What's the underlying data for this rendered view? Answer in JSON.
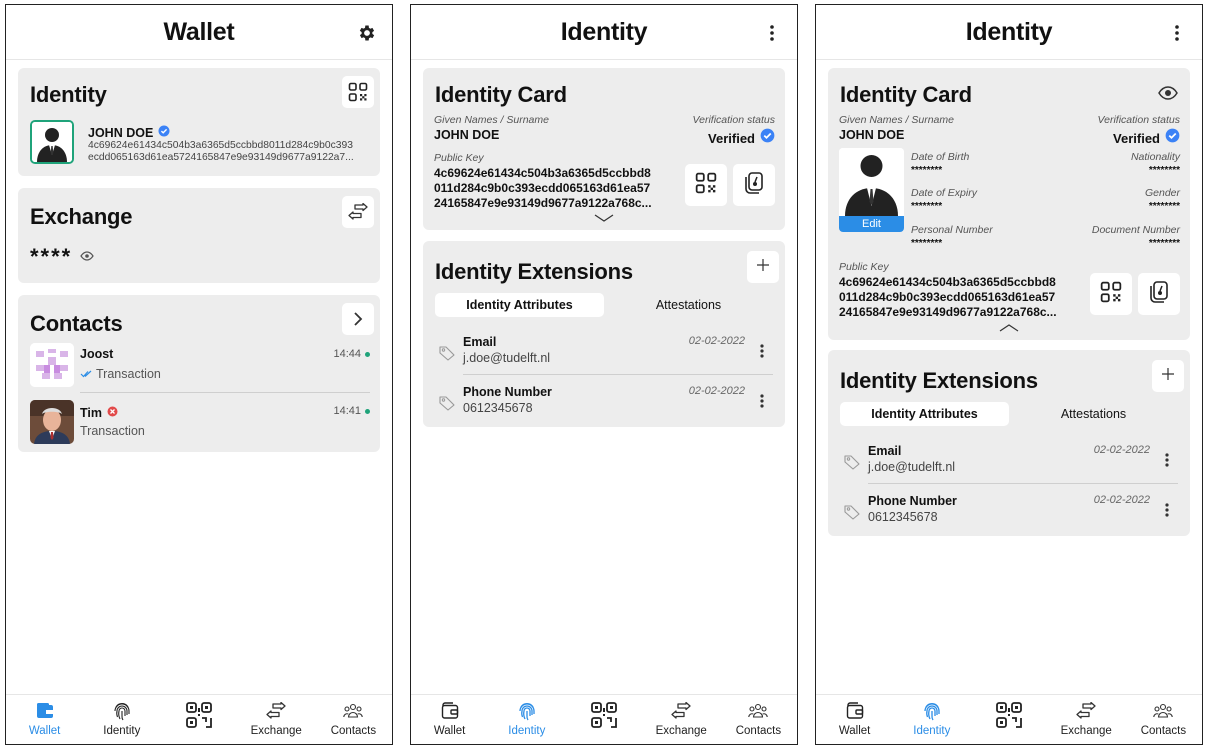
{
  "screens": {
    "wallet": {
      "title": "Wallet",
      "identity": {
        "title": "Identity",
        "name": "JOHN DOE",
        "key_line1": "4c69624e61434c504b3a6365d5ccbbd8011d284c9b0c393",
        "key_line2": "ecdd065163d61ea5724165847e9e93149d9677a9122a7..."
      },
      "exchange": {
        "title": "Exchange",
        "balance": "****"
      },
      "contacts": {
        "title": "Contacts",
        "items": [
          {
            "name": "Joost",
            "time": "14:44",
            "subtitle": "Transaction"
          },
          {
            "name": "Tim",
            "time": "14:41",
            "subtitle": "Transaction"
          }
        ]
      }
    },
    "identity": {
      "title": "Identity",
      "card_title": "Identity Card",
      "given_names_label": "Given Names / Surname",
      "name": "JOHN DOE",
      "verification_label": "Verification status",
      "verification_value": "Verified",
      "public_key_label": "Public Key",
      "public_key_line1": "4c69624e61434c504b3a6365d5ccbbd8",
      "public_key_line2": "011d284c9b0c393ecdd065163d61ea57",
      "public_key_line3": "24165847e9e93149d9677a9122a768c...",
      "extensions_title": "Identity Extensions",
      "tabs": [
        "Identity Attributes",
        "Attestations"
      ],
      "attributes": [
        {
          "name": "Email",
          "value": "j.doe@tudelft.nl",
          "date": "02-02-2022"
        },
        {
          "name": "Phone Number",
          "value": "0612345678",
          "date": "02-02-2022"
        }
      ],
      "expanded": {
        "dob_label": "Date of Birth",
        "dob_value": "********",
        "nationality_label": "Nationality",
        "nationality_value": "********",
        "expiry_label": "Date of Expiry",
        "expiry_value": "********",
        "gender_label": "Gender",
        "gender_value": "********",
        "personal_label": "Personal Number",
        "personal_value": "********",
        "document_label": "Document Number",
        "document_value": "********",
        "edit_label": "Edit"
      }
    }
  },
  "nav": {
    "items": [
      "Wallet",
      "Identity",
      "",
      "Exchange",
      "Contacts"
    ]
  },
  "colors": {
    "accent": "#2b8de6",
    "verified": "#3b82f6",
    "red": "#e24a4a",
    "green": "#1fa37a"
  }
}
